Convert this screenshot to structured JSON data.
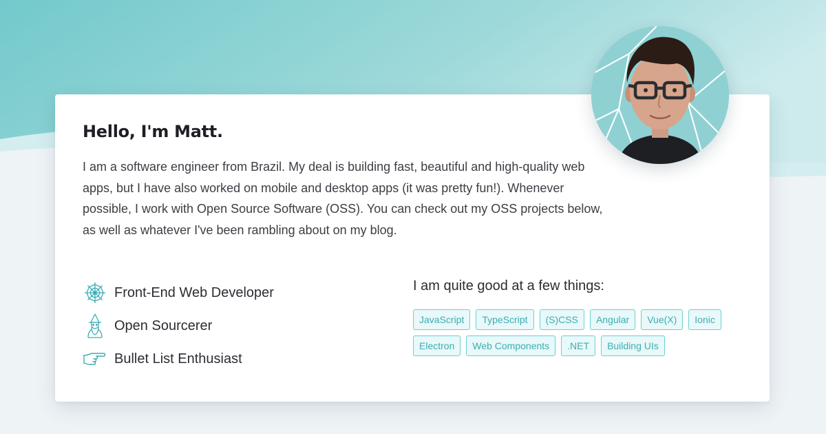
{
  "intro": {
    "greeting": "Hello, I'm Matt.",
    "bio": "I am a software engineer from Brazil. My deal is building fast, beautiful and high-quality web apps, but I have also worked on mobile and desktop apps (it was pretty fun!). Whenever possible, I work with Open Source Software (OSS). You can check out my OSS projects below, as well as whatever I've been rambling about on my blog."
  },
  "roles": [
    {
      "label": "Front-End Web Developer",
      "icon": "spider-web-icon"
    },
    {
      "label": "Open Sourcerer",
      "icon": "wizard-icon"
    },
    {
      "label": "Bullet List Enthusiast",
      "icon": "pointing-hand-icon"
    }
  ],
  "skills": {
    "heading": "I am quite good at a few things:",
    "tags": [
      "JavaScript",
      "TypeScript",
      "(S)CSS",
      "Angular",
      "Vue(X)",
      "Ionic",
      "Electron",
      "Web Components",
      ".NET",
      "Building UIs"
    ]
  },
  "colors": {
    "accent": "#3aaeb3",
    "tag_border": "#6ccfd3",
    "tag_background": "#e9f8f9",
    "hero_teal": "#7fcfd0",
    "page_background": "#eef3f6"
  }
}
